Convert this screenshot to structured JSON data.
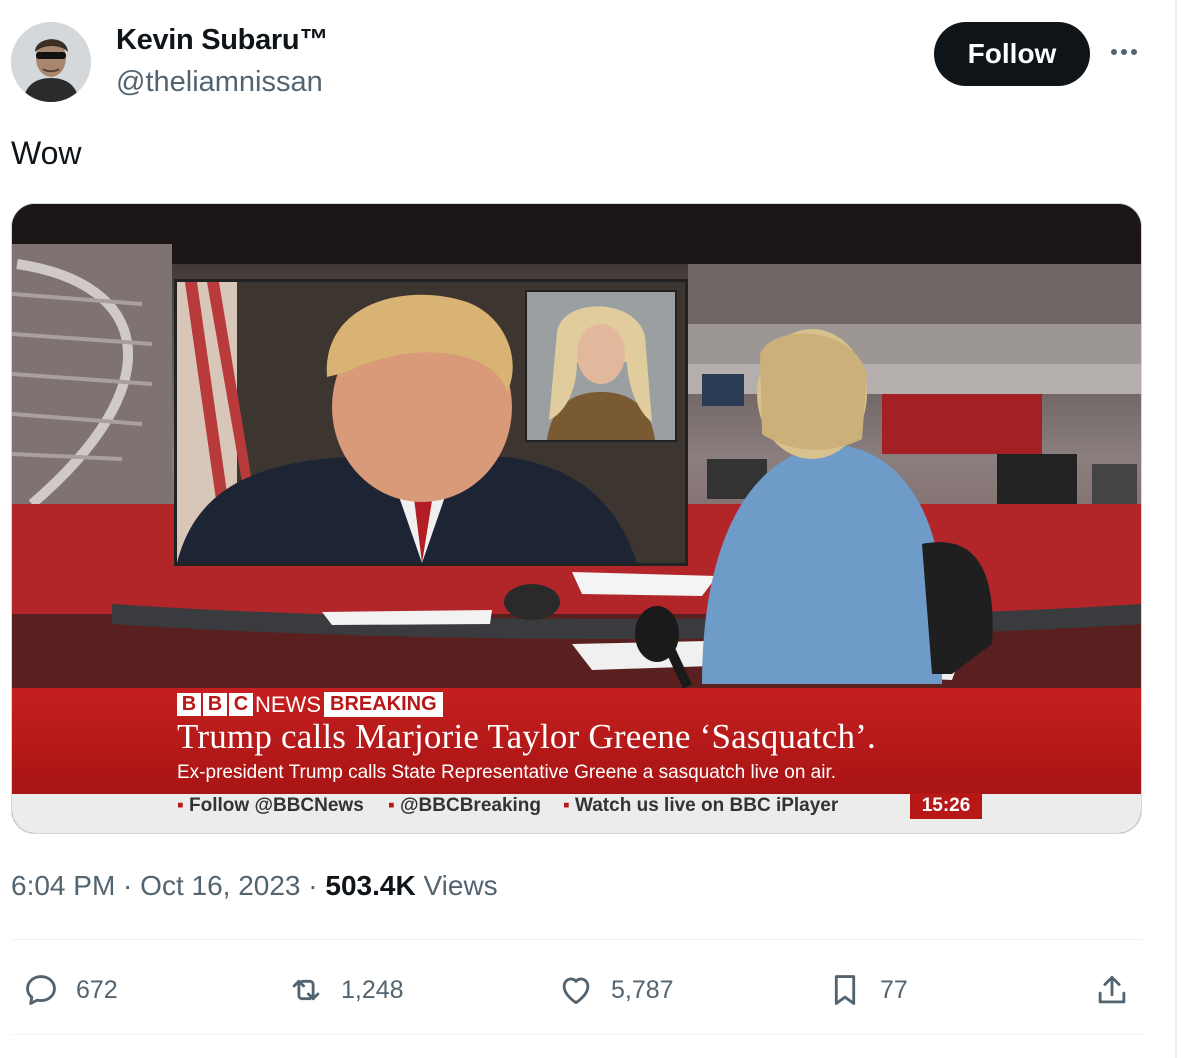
{
  "author": {
    "name": "Kevin Subaru™",
    "handle": "@theliamnissan"
  },
  "follow_label": "Follow",
  "tweet_text": "Wow",
  "media": {
    "logo_letters": [
      "B",
      "B",
      "C"
    ],
    "news_label": "NEWS",
    "breaking_label": "BREAKING",
    "headline": "Trump calls Marjorie Taylor Greene ‘Sasquatch’.",
    "subhead": "Ex-president Trump calls State Representative Greene a sasquatch live on air.",
    "ticker": [
      "Follow @BBCNews",
      "@BBCBreaking",
      "Watch us live on BBC iPlayer"
    ],
    "clock": "15:26"
  },
  "meta": {
    "time": "6:04 PM",
    "separator": " · ",
    "date": "Oct 16, 2023",
    "views_count": "503.4K",
    "views_label": " Views"
  },
  "actions": {
    "replies": "672",
    "reposts": "1,248",
    "likes": "5,787",
    "bookmarks": "77"
  },
  "colors": {
    "text": "#0f1419",
    "muted": "#536471",
    "bbc_red": "#b81717"
  }
}
